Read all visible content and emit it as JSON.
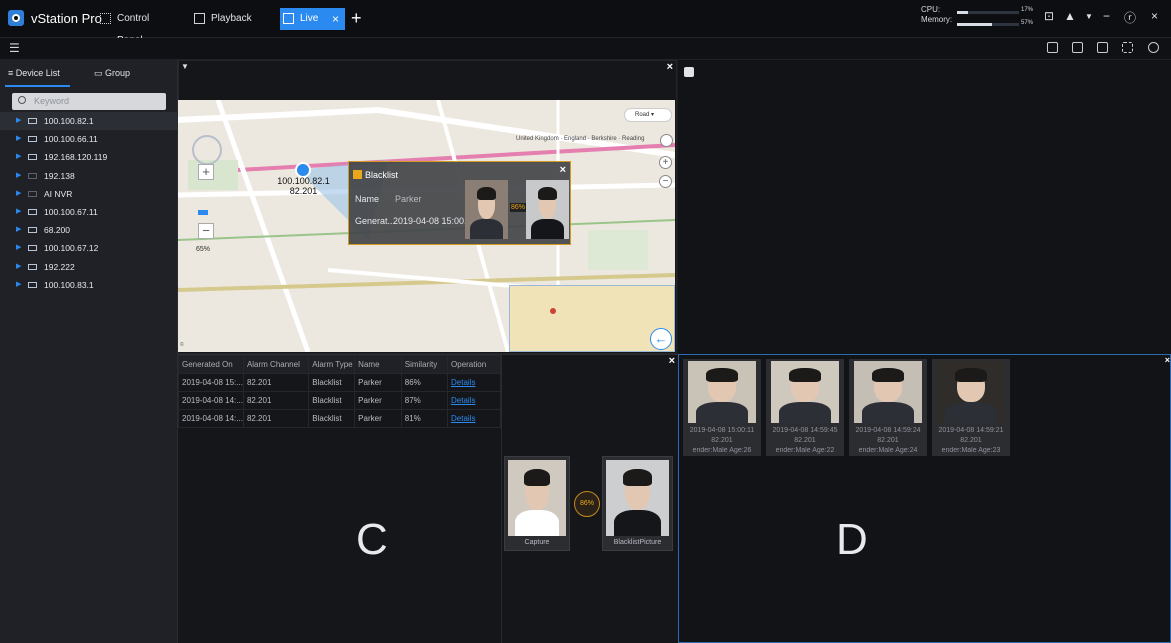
{
  "app": {
    "title": "vStation Pro"
  },
  "tabs": [
    {
      "label": "Control Panel"
    },
    {
      "label": "Playback"
    },
    {
      "label": "Live"
    }
  ],
  "system": {
    "cpu_label": "CPU:",
    "memory_label": "Memory:",
    "cpu_pct_label": "17%",
    "memory_pct_label": "57%",
    "cpu_value": 0.17,
    "memory_value": 0.57
  },
  "sidebar": {
    "tab_device": "Device List",
    "tab_group": "Group",
    "search_placeholder": "Keyword",
    "devices": [
      {
        "label": "100.100.82.1"
      },
      {
        "label": "100.100.66.11"
      },
      {
        "label": "192.168.120.119"
      },
      {
        "label": "192.138"
      },
      {
        "label": "AI NVR"
      },
      {
        "label": "100.100.67.11"
      },
      {
        "label": "68.200"
      },
      {
        "label": "100.100.67.12"
      },
      {
        "label": "192.222"
      },
      {
        "label": "100.100.83.1"
      }
    ]
  },
  "map": {
    "road_label": "Road",
    "location": "United Kingdom · England · Berkshire · Reading",
    "device_ip": "100.100.82.1",
    "device_channel": "82.201",
    "zoom": "65%",
    "popup": {
      "title": "Blacklist",
      "name_label": "Name",
      "name_value": "Parker",
      "generated_label": "Generat...",
      "generated_value": "2019-04-08 15:00...",
      "similarity": "86%"
    }
  },
  "alarm_table": {
    "headers": [
      "Generated On",
      "Alarm Channel",
      "Alarm Type",
      "Name",
      "Similarity",
      "Operation"
    ],
    "rows": [
      [
        "2019-04-08 15:...",
        "82.201",
        "Blacklist",
        "Parker",
        "86%",
        "Details"
      ],
      [
        "2019-04-08 14:...",
        "82.201",
        "Blacklist",
        "Parker",
        "87%",
        "Details"
      ],
      [
        "2019-04-08 14:...",
        "82.201",
        "Blacklist",
        "Parker",
        "81%",
        "Details"
      ]
    ]
  },
  "compare": {
    "capture_label": "Capture",
    "blacklist_label": "BlacklistPicture",
    "similarity": "86%"
  },
  "panes": {
    "c_label": "C",
    "d_label": "D"
  },
  "snapshots": [
    {
      "time": "2019-04-08 15:00:11",
      "channel": "82.201",
      "info": "ender:Male Age:26"
    },
    {
      "time": "2019-04-08 14:59:45",
      "channel": "82.201",
      "info": "ender:Male Age:22"
    },
    {
      "time": "2019-04-08 14:59:24",
      "channel": "82.201",
      "info": "ender:Male Age:24"
    },
    {
      "time": "2019-04-08 14:59:21",
      "channel": "82.201",
      "info": "ender:Male Age:23"
    }
  ]
}
